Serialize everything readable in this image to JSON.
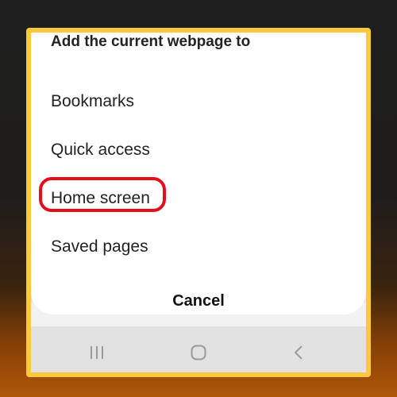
{
  "dialog": {
    "title": "Add the current webpage to",
    "options": [
      {
        "label": "Bookmarks"
      },
      {
        "label": "Quick access"
      },
      {
        "label": "Home screen"
      },
      {
        "label": "Saved pages"
      }
    ],
    "cancel_label": "Cancel"
  },
  "highlighted_option": "Home screen",
  "navigation_bar": {
    "buttons": [
      "recent-apps",
      "home",
      "back"
    ]
  },
  "colors": {
    "frame_border": "#fcc93a",
    "highlight_ring": "#e3101b",
    "sheet_background": "#ffffff",
    "nav_background": "#e2e2e2"
  }
}
